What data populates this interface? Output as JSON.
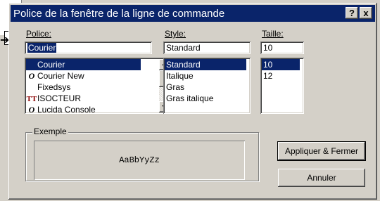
{
  "dialog": {
    "title": "Police de la fenêtre de la ligne de commande",
    "help_label": "?",
    "close_label": "x"
  },
  "font": {
    "label": "Police:",
    "value": "Courier",
    "items": [
      {
        "label": "Courier",
        "icon": "none",
        "selected": true
      },
      {
        "label": "Courier New",
        "icon": "opentype-font-icon",
        "selected": false
      },
      {
        "label": "Fixedsys",
        "icon": "none",
        "selected": false
      },
      {
        "label": "ISOCTEUR",
        "icon": "truetype-font-icon",
        "selected": false
      },
      {
        "label": "Lucida Console",
        "icon": "opentype-font-icon",
        "selected": false
      }
    ]
  },
  "style": {
    "label": "Style:",
    "value": "Standard",
    "items": [
      {
        "label": "Standard",
        "selected": true
      },
      {
        "label": "Italique",
        "selected": false
      },
      {
        "label": "Gras",
        "selected": false
      },
      {
        "label": "Gras italique",
        "selected": false
      }
    ]
  },
  "size": {
    "label": "Taille:",
    "value": "10",
    "items": [
      {
        "label": "10",
        "selected": true
      },
      {
        "label": "12",
        "selected": false
      }
    ]
  },
  "sample": {
    "label": "Exemple",
    "text": "AaBbYyZz"
  },
  "buttons": {
    "apply_close": "Appliquer & Fermer",
    "cancel": "Annuler"
  },
  "colors": {
    "selection": "#0a246a",
    "face": "#d4d0c8"
  }
}
